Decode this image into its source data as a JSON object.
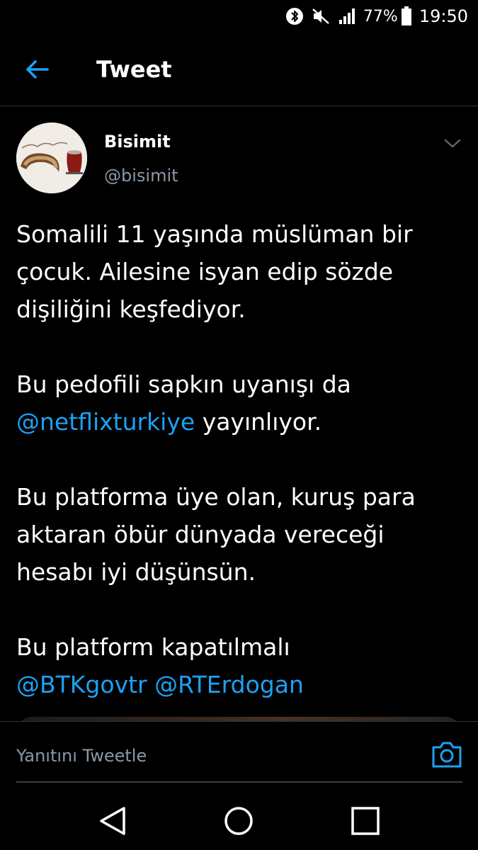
{
  "status_bar": {
    "bluetooth_icon": "bluetooth-icon",
    "mute_icon": "mute-icon",
    "signal_icon": "signal-icon",
    "battery_percent": "77%",
    "time": "19:50"
  },
  "app_bar": {
    "title": "Tweet",
    "back_icon": "arrow-left-icon"
  },
  "tweet": {
    "author_name": "Bisimit",
    "author_handle": "@bisimit",
    "paragraphs": {
      "p1": "Somalili 11 yaşında müslüman bir çocuk. Ailesine isyan edip sözde dişiliğini keşfediyor.",
      "p2_text": "Bu pedofili sapkın uyanışı da",
      "p2_mention": "@netflixturkiye",
      "p2_after": "yayınlıyor.",
      "p3": "Bu platforma üye olan, kuruş para aktaran öbür dünyada vereceği hesabı iyi düşünsün.",
      "p4_text": "Bu platform kapatılmalı",
      "p4_mention1": "@BTKgovtr",
      "p4_mention2": "@RTErdogan"
    }
  },
  "reply_bar": {
    "placeholder": "Yanıtını Tweetle",
    "camera_icon": "camera-icon"
  },
  "nav_bar": {
    "back_icon": "nav-back-triangle-icon",
    "home_icon": "nav-home-circle-icon",
    "recents_icon": "nav-recents-square-icon"
  },
  "colors": {
    "background": "#000000",
    "accent": "#1da1f2",
    "secondary_text": "#8b98a5",
    "divider": "#2f3336"
  }
}
